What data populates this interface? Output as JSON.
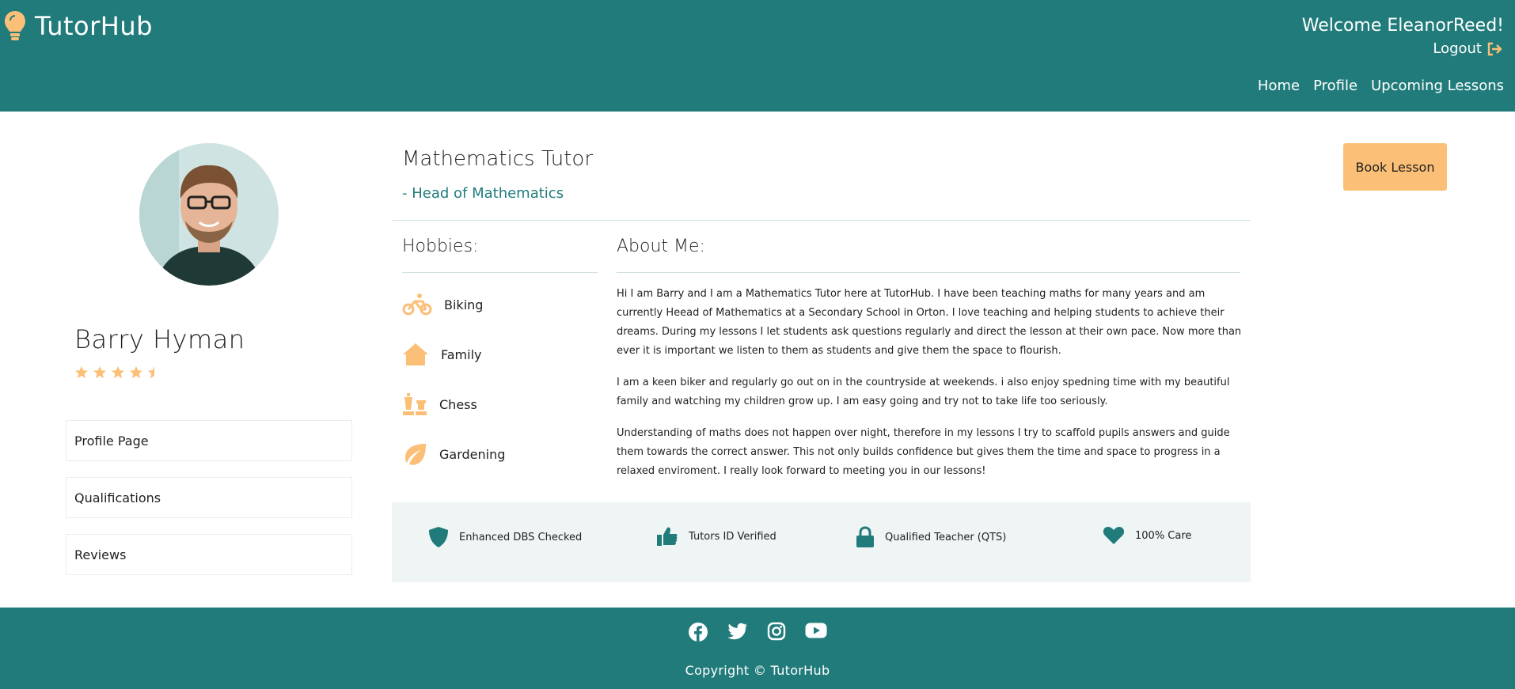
{
  "header": {
    "brand": "TutorHub",
    "welcome": "Welcome EleanorReed!",
    "logout": "Logout",
    "nav": [
      "Home",
      "Profile",
      "Upcoming Lessons"
    ]
  },
  "tutor": {
    "name": "Barry Hyman",
    "rating": 4.5,
    "title": "Mathematics Tutor",
    "subtitle": "- Head of Mathematics"
  },
  "sidebar": {
    "items": [
      "Profile Page",
      "Qualifications",
      "Reviews"
    ]
  },
  "hobbies": {
    "title": "Hobbies:",
    "items": [
      {
        "label": "Biking",
        "icon": "bicycle-icon"
      },
      {
        "label": "Family",
        "icon": "house-icon"
      },
      {
        "label": "Chess",
        "icon": "chess-icon"
      },
      {
        "label": "Gardening",
        "icon": "leaf-icon"
      }
    ]
  },
  "about": {
    "title": "About Me:",
    "paragraphs": [
      "Hi I am Barry and I am a Mathematics Tutor here at TutorHub. I have been teaching maths for many years and am currently Heead of Mathematics at a Secondary School in Orton. I love teaching and helping students to achieve their dreams. During my lessons I let students ask questions regularly and direct the lesson at their own pace. Now more than ever it is important we listen to them as students and give them the space to flourish.",
      "I am a keen biker and regularly go out on in the countryside at weekends. i also enjoy spedning time with my beautiful family and watching my children grow up. I am easy going and try not to take life too seriously.",
      "Understanding of maths does not happen over night, therefore in my lessons I try to scaffold pupils answers and guide them towards the correct answer. This not only builds confidence but gives them the time and space to progress in a relaxed enviroment. I really look forward to meeting you in our lessons!"
    ]
  },
  "badges": [
    {
      "label": "Enhanced DBS Checked",
      "icon": "shield-icon"
    },
    {
      "label": "Tutors ID Verified",
      "icon": "thumbs-up-icon"
    },
    {
      "label": "Qualified Teacher (QTS)",
      "icon": "lock-icon"
    },
    {
      "label": "100% Care",
      "icon": "heart-icon"
    }
  ],
  "book_button": "Book Lesson",
  "footer": {
    "social": [
      "facebook-icon",
      "twitter-icon",
      "instagram-icon",
      "youtube-icon"
    ],
    "copyright": "Copyright © TutorHub"
  },
  "colors": {
    "primary": "#217b7b",
    "accent": "#fbbf77",
    "badge_bg": "#eef5f4"
  }
}
